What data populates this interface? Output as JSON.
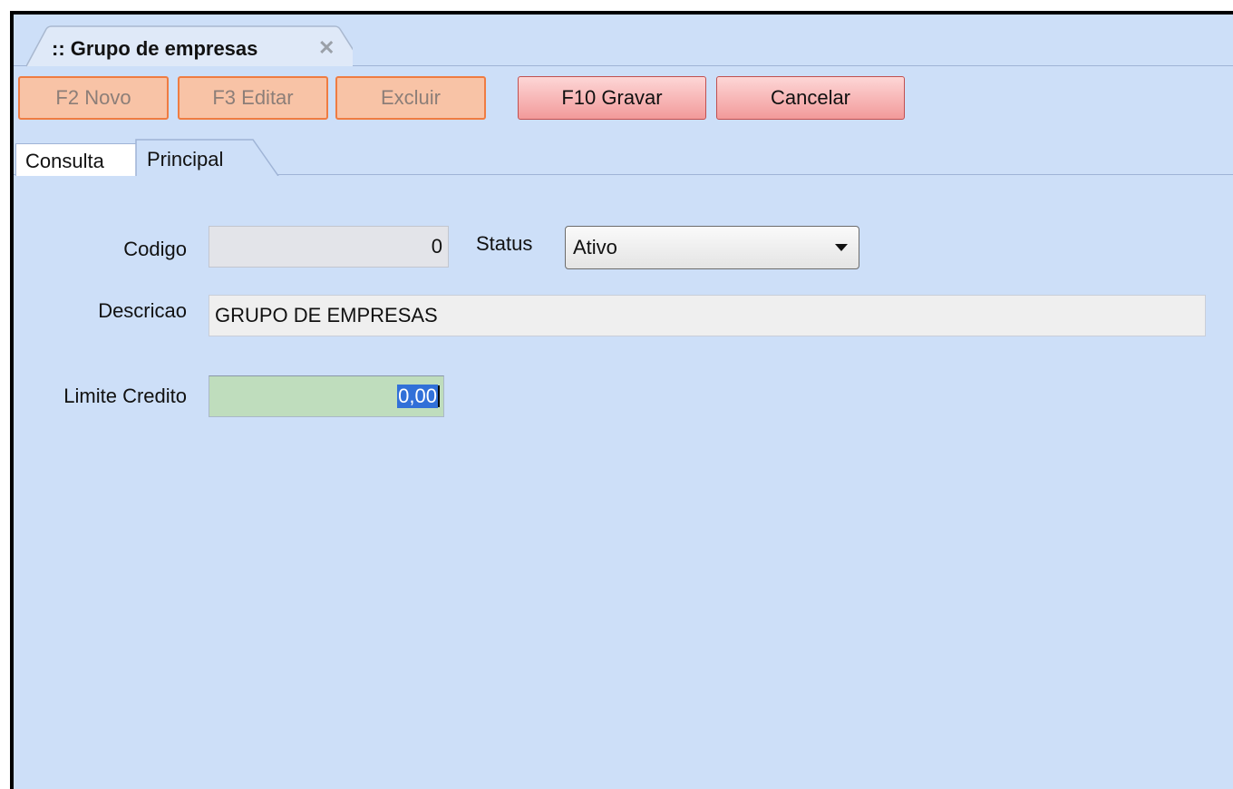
{
  "doc_tab": {
    "title": ":: Grupo de empresas",
    "close_label": "✕"
  },
  "toolbar": {
    "novo_label": "F2 Novo",
    "editar_label": "F3 Editar",
    "excluir_label": "Excluir",
    "gravar_label": "F10 Gravar",
    "cancelar_label": "Cancelar"
  },
  "page_tabs": {
    "consulta_label": "Consulta",
    "principal_label": "Principal"
  },
  "form": {
    "codigo_label": "Codigo",
    "codigo_value": "0",
    "status_label": "Status",
    "status_value": "Ativo",
    "descricao_label": "Descricao",
    "descricao_value": "GRUPO DE EMPRESAS",
    "limite_label": "Limite Credito",
    "limite_value": "0,00"
  },
  "colors": {
    "background": "#cddff8",
    "disabled_button": "#f8c3a6",
    "active_button": "#f29a9a",
    "limite_field": "#bfddbd"
  }
}
